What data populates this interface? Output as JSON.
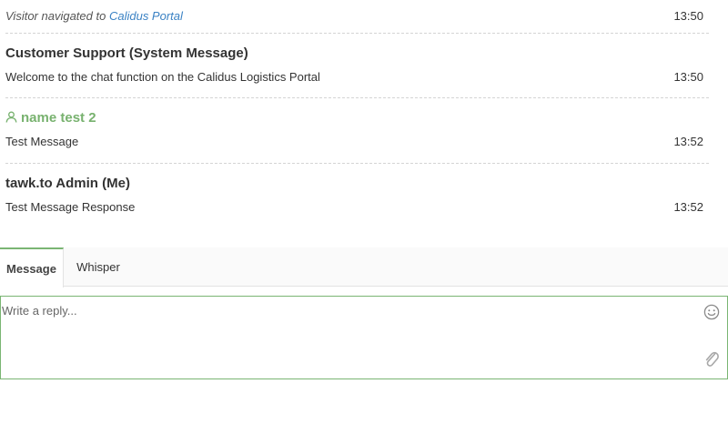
{
  "messages": {
    "event": {
      "prefix": "Visitor navigated to",
      "link": "Calidus Portal",
      "time": "13:50"
    },
    "items": [
      {
        "sender": "Customer Support (System Message)",
        "text": "Welcome to the chat function on the Calidus Logistics Portal",
        "time": "13:50"
      },
      {
        "sender": "name test 2",
        "text": "Test Message",
        "time": "13:52"
      },
      {
        "sender": "tawk.to Admin (Me)",
        "text": "Test Message Response",
        "time": "13:52"
      }
    ]
  },
  "tabs": [
    {
      "label": "Message",
      "active": true
    },
    {
      "label": "Whisper",
      "active": false
    }
  ],
  "reply": {
    "placeholder": "Write a reply..."
  },
  "colors": {
    "visitor": "#78b26f",
    "link": "#3b82c4",
    "accent": "#7ab573"
  },
  "icons": {
    "visitor": "user-icon",
    "emoji": "smiley-icon",
    "attach": "paperclip-icon"
  }
}
